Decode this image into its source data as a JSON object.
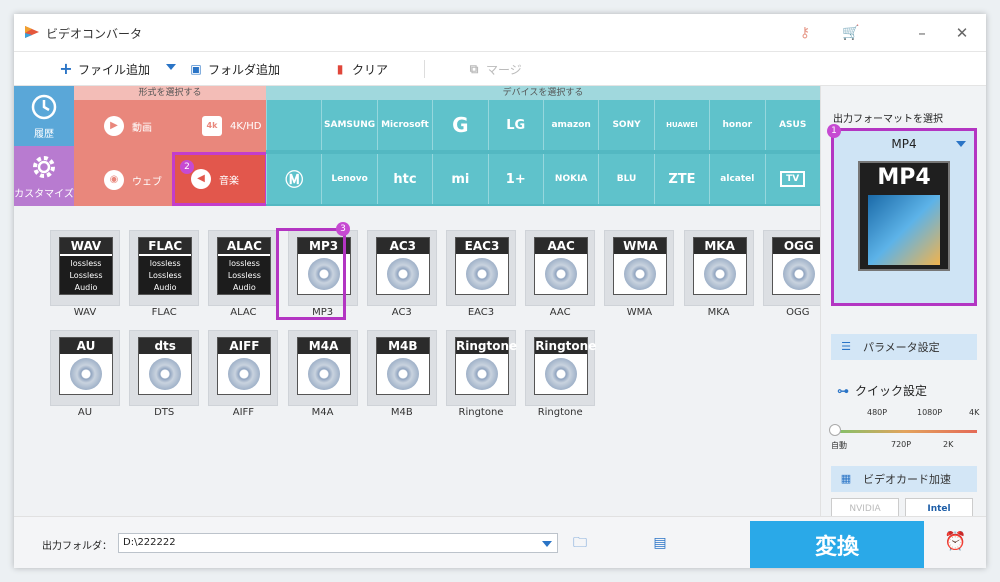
{
  "window": {
    "title": "ビデオコンバータ"
  },
  "toolbar": {
    "add_file": "ファイル追加",
    "add_folder": "フォルダ追加",
    "clear": "クリア",
    "merge": "マージ"
  },
  "sidebar": {
    "history": "履歴",
    "custom": "カスタマイズ"
  },
  "format_select": {
    "header": "形式を選択する",
    "items": [
      "動画",
      "4K/HD",
      "ウェブ",
      "音楽"
    ]
  },
  "device_select": {
    "header": "デバイスを選択する",
    "brands": [
      "",
      "SAMSUNG",
      "Microsoft",
      "G",
      "LG",
      "amazon",
      "SONY",
      "HUAWEI",
      "honor",
      "ASUS",
      "",
      "Lenovo",
      "htc",
      "mi",
      "1+",
      "NOKIA",
      "BLU",
      "ZTE",
      "alcatel",
      "TV"
    ]
  },
  "audio_formats": [
    {
      "label": "WAV",
      "badge": "WAV",
      "lossless": true
    },
    {
      "label": "FLAC",
      "badge": "FLAC",
      "lossless": true
    },
    {
      "label": "ALAC",
      "badge": "ALAC",
      "lossless": true
    },
    {
      "label": "MP3",
      "badge": "MP3",
      "lossless": false
    },
    {
      "label": "AC3",
      "badge": "AC3",
      "lossless": false
    },
    {
      "label": "EAC3",
      "badge": "EAC3",
      "lossless": false
    },
    {
      "label": "AAC",
      "badge": "AAC",
      "lossless": false
    },
    {
      "label": "WMA",
      "badge": "WMA",
      "lossless": false
    },
    {
      "label": "MKA",
      "badge": "MKA",
      "lossless": false
    },
    {
      "label": "OGG",
      "badge": "OGG",
      "lossless": false
    },
    {
      "label": "AU",
      "badge": "AU",
      "lossless": false
    },
    {
      "label": "DTS",
      "badge": "dts",
      "lossless": false
    },
    {
      "label": "AIFF",
      "badge": "AIFF",
      "lossless": false
    },
    {
      "label": "M4A",
      "badge": "M4A",
      "lossless": false
    },
    {
      "label": "M4B",
      "badge": "M4B",
      "lossless": false
    },
    {
      "label": "Ringtone",
      "badge": "Ringtone",
      "lossless": false
    },
    {
      "label": "Ringtone",
      "badge": "Ringtone",
      "lossless": false
    }
  ],
  "lossless_text": "lossless Lossless Audio",
  "output": {
    "title": "出力フォーマットを選択",
    "format": "MP4",
    "param_button": "パラメータ設定",
    "quick_title": "クイック設定",
    "quality_top": [
      "480P",
      "1080P",
      "4K"
    ],
    "quality_bottom": [
      "自動",
      "720P",
      "2K"
    ],
    "gpu_button": "ビデオカード加速",
    "nvidia": "NVIDIA",
    "intel": "Intel"
  },
  "bottom": {
    "folder_label": "出力フォルダ：",
    "folder_value": "D:\\222222",
    "convert": "変換"
  },
  "colors": {
    "accent": "#2aa9e8",
    "highlight": "#b335c2",
    "format_band": "#e9877c",
    "device_band": "#53b8c2"
  }
}
